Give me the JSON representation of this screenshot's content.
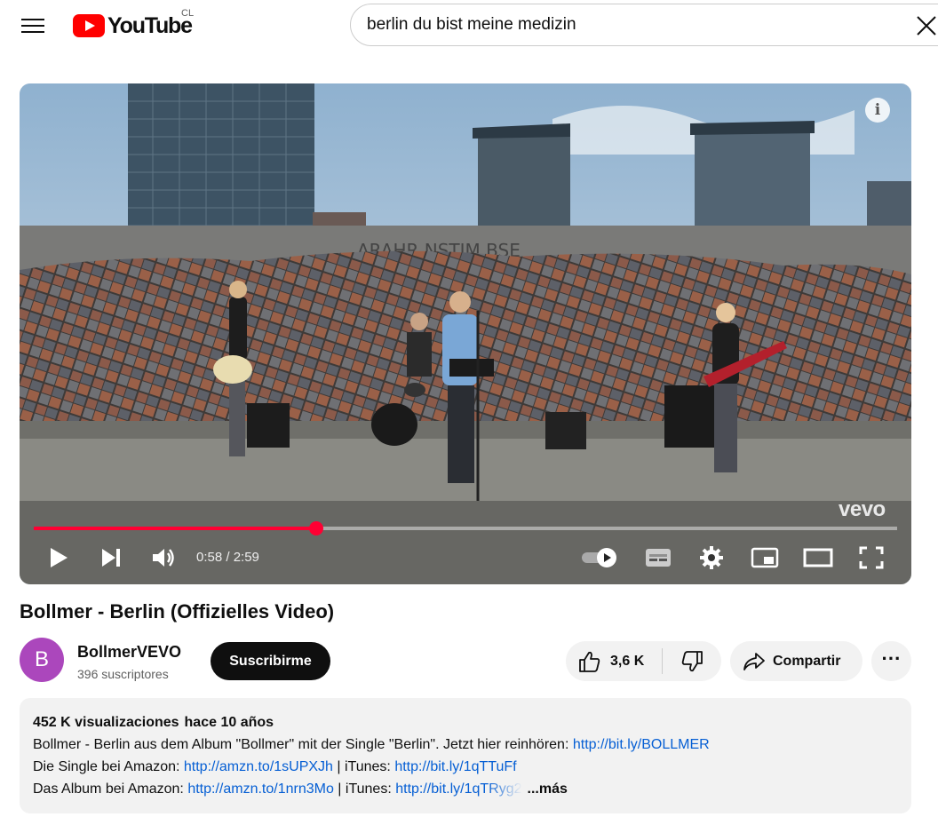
{
  "header": {
    "logo_text": "YouTube",
    "country_code": "CL",
    "search_value": "berlin du bist meine medizin"
  },
  "player": {
    "vevo_watermark": "vevo",
    "info_label": "i",
    "time_display": "0:58 / 2:59",
    "progress_fraction": 0.327,
    "icons": [
      "play-icon",
      "next-icon",
      "volume-icon",
      "autoplay-toggle-icon",
      "subtitles-icon",
      "settings-icon",
      "miniplayer-icon",
      "theater-mode-icon",
      "fullscreen-icon"
    ]
  },
  "video": {
    "title": "Bollmer - Berlin (Offizielles Video)"
  },
  "channel": {
    "avatar_letter": "B",
    "avatar_color": "#ab47bc",
    "name": "BollmerVEVO",
    "subscribers": "396 suscriptores",
    "subscribe_label": "Suscribirme"
  },
  "actions": {
    "like_count": "3,6 K",
    "share_label": "Compartir",
    "more_label": "···"
  },
  "description": {
    "views": "452 K visualizaciones",
    "age": "hace 10 años",
    "line1_text": "Bollmer - Berlin aus dem Album \"Bollmer\" mit der Single \"Berlin\". Jetzt hier reinhören: ",
    "line1_link": "http://bit.ly/BOLLMER",
    "line2_text": "Die Single bei Amazon: ",
    "line2_link1": "http://amzn.to/1sUPXJh",
    "line2_sep": " | iTunes: ",
    "line2_link2": "http://bit.ly/1qTTuFf",
    "line3_text": "Das Album bei Amazon: ",
    "line3_link1": "http://amzn.to/1nrn3Mo",
    "line3_sep": " | iTunes: ",
    "line3_link2": "http://bit.ly/1qTRyg2",
    "more_label": "...más"
  },
  "colors": {
    "brand_red": "#ff0000",
    "progress_red": "#ff0033",
    "link_blue": "#065fd4"
  }
}
